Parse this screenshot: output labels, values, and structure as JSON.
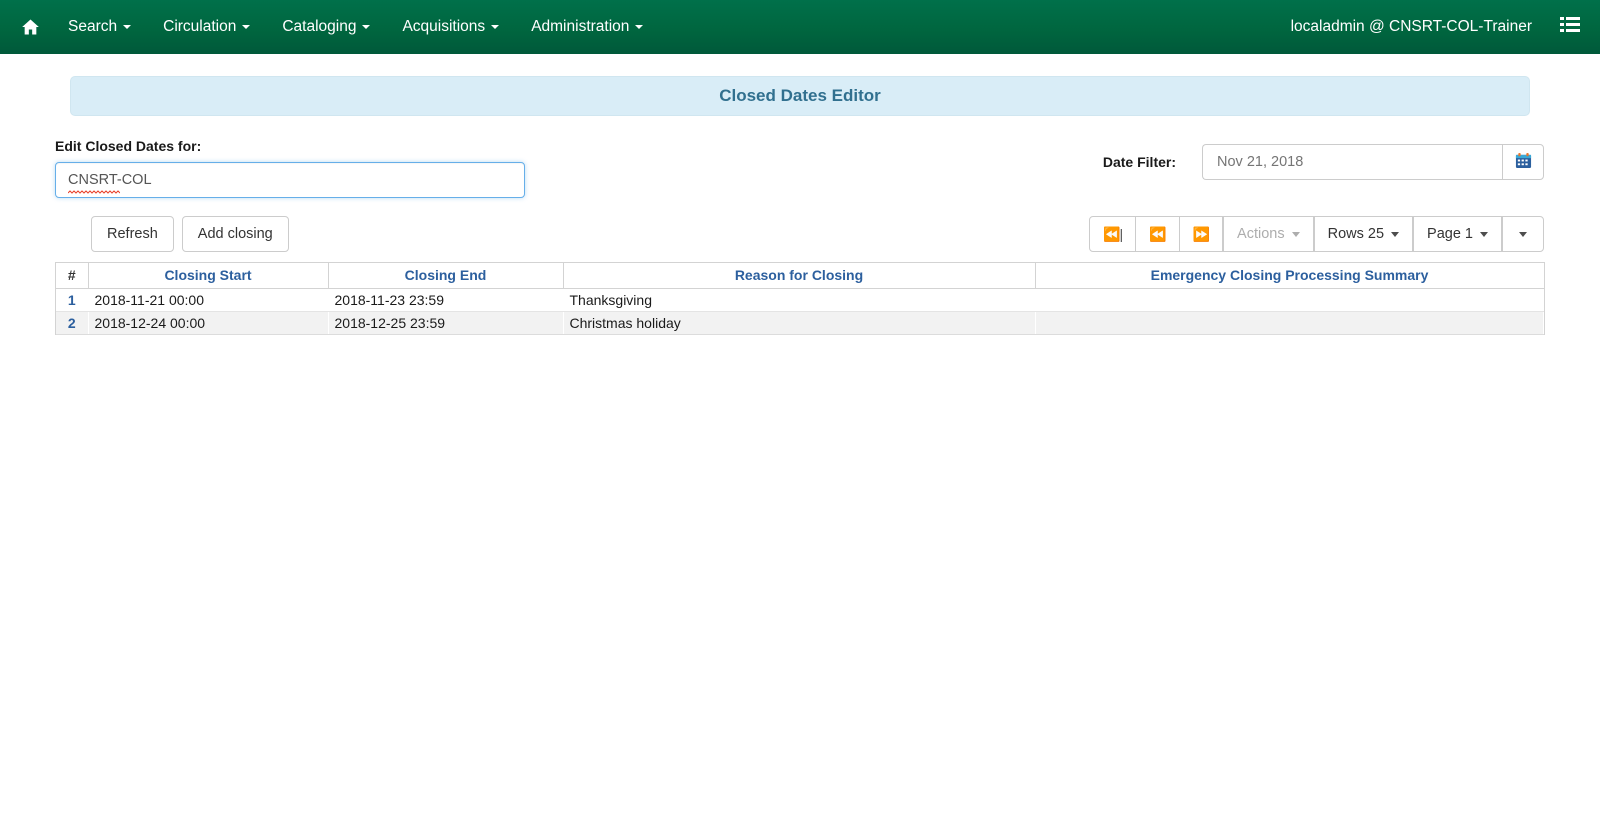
{
  "navbar": {
    "home_icon": "home-icon",
    "menus": [
      {
        "label": "Search"
      },
      {
        "label": "Circulation"
      },
      {
        "label": "Cataloging"
      },
      {
        "label": "Acquisitions"
      },
      {
        "label": "Administration"
      }
    ],
    "user": "localadmin @ CNSRT-COL-Trainer",
    "menu_icon": "list-menu-icon",
    "background_color": "#00664a"
  },
  "banner": {
    "title": "Closed Dates Editor",
    "background_color": "#d9edf7",
    "text_color": "#31708f"
  },
  "filters": {
    "org_label": "Edit Closed Dates for:",
    "org_value": "CNSRT-COL",
    "org_placeholder": "",
    "date_label": "Date Filter:",
    "date_value": "Nov 21, 2018",
    "date_placeholder": "Nov 21, 2018",
    "calendar_icon": "calendar-icon"
  },
  "toolbar": {
    "refresh_label": "Refresh",
    "add_closing_label": "Add closing"
  },
  "pager": {
    "first_page_icon": "first-page-icon",
    "prev_page_icon": "previous-page-icon",
    "next_page_icon": "next-page-icon",
    "actions_label": "Actions",
    "rows_label": "Rows 25",
    "page_label": "Page 1",
    "more_icon": "chevron-down-icon"
  },
  "grid": {
    "columns": [
      {
        "key": "num",
        "label": "#"
      },
      {
        "key": "start",
        "label": "Closing Start"
      },
      {
        "key": "end",
        "label": "Closing End"
      },
      {
        "key": "reason",
        "label": "Reason for Closing"
      },
      {
        "key": "summary",
        "label": "Emergency Closing Processing Summary"
      }
    ],
    "rows": [
      {
        "num": "1",
        "start": "2018-11-21 00:00",
        "end": "2018-11-23 23:59",
        "reason": "Thanksgiving",
        "summary": ""
      },
      {
        "num": "2",
        "start": "2018-12-24 00:00",
        "end": "2018-12-25 23:59",
        "reason": "Christmas holiday",
        "summary": ""
      }
    ]
  }
}
